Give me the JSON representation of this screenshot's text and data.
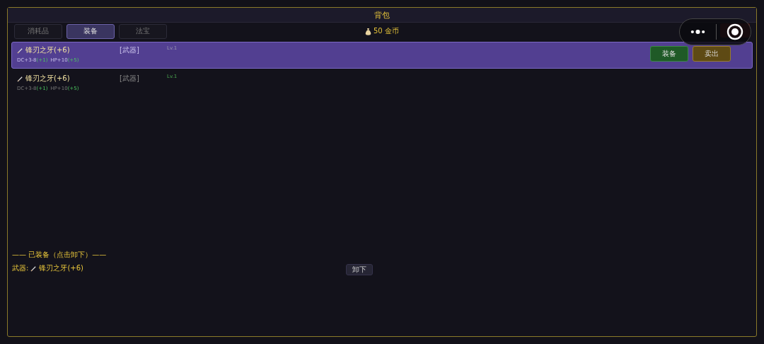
{
  "window": {
    "title": "背包"
  },
  "tabs": [
    {
      "label": "消耗品",
      "selected": false
    },
    {
      "label": "装备",
      "selected": true
    },
    {
      "label": "法宝",
      "selected": false
    }
  ],
  "gold": "50 金币",
  "items": [
    {
      "name": "锋刃之牙(+6)",
      "stats": [
        {
          "base": "DC+3-8",
          "bonus": "(+1)"
        },
        {
          "base": "HP+10",
          "bonus": "(+5)"
        }
      ],
      "type": "[武器]",
      "level": "Lv.1",
      "selected": true,
      "actions": [
        "装备",
        "卖出"
      ]
    },
    {
      "name": "锋刃之牙(+6)",
      "stats": [
        {
          "base": "DC+3-8",
          "bonus": "(+1)"
        },
        {
          "base": "HP+10",
          "bonus": "(+5)"
        }
      ],
      "type": "[武器]",
      "level": "Lv.1",
      "selected": false
    }
  ],
  "equipped": {
    "heading": "—— 已装备（点击卸下）——",
    "slots": [
      {
        "label": "武器:",
        "name": "锋刃之牙(+6)",
        "button": "卸下"
      }
    ]
  }
}
